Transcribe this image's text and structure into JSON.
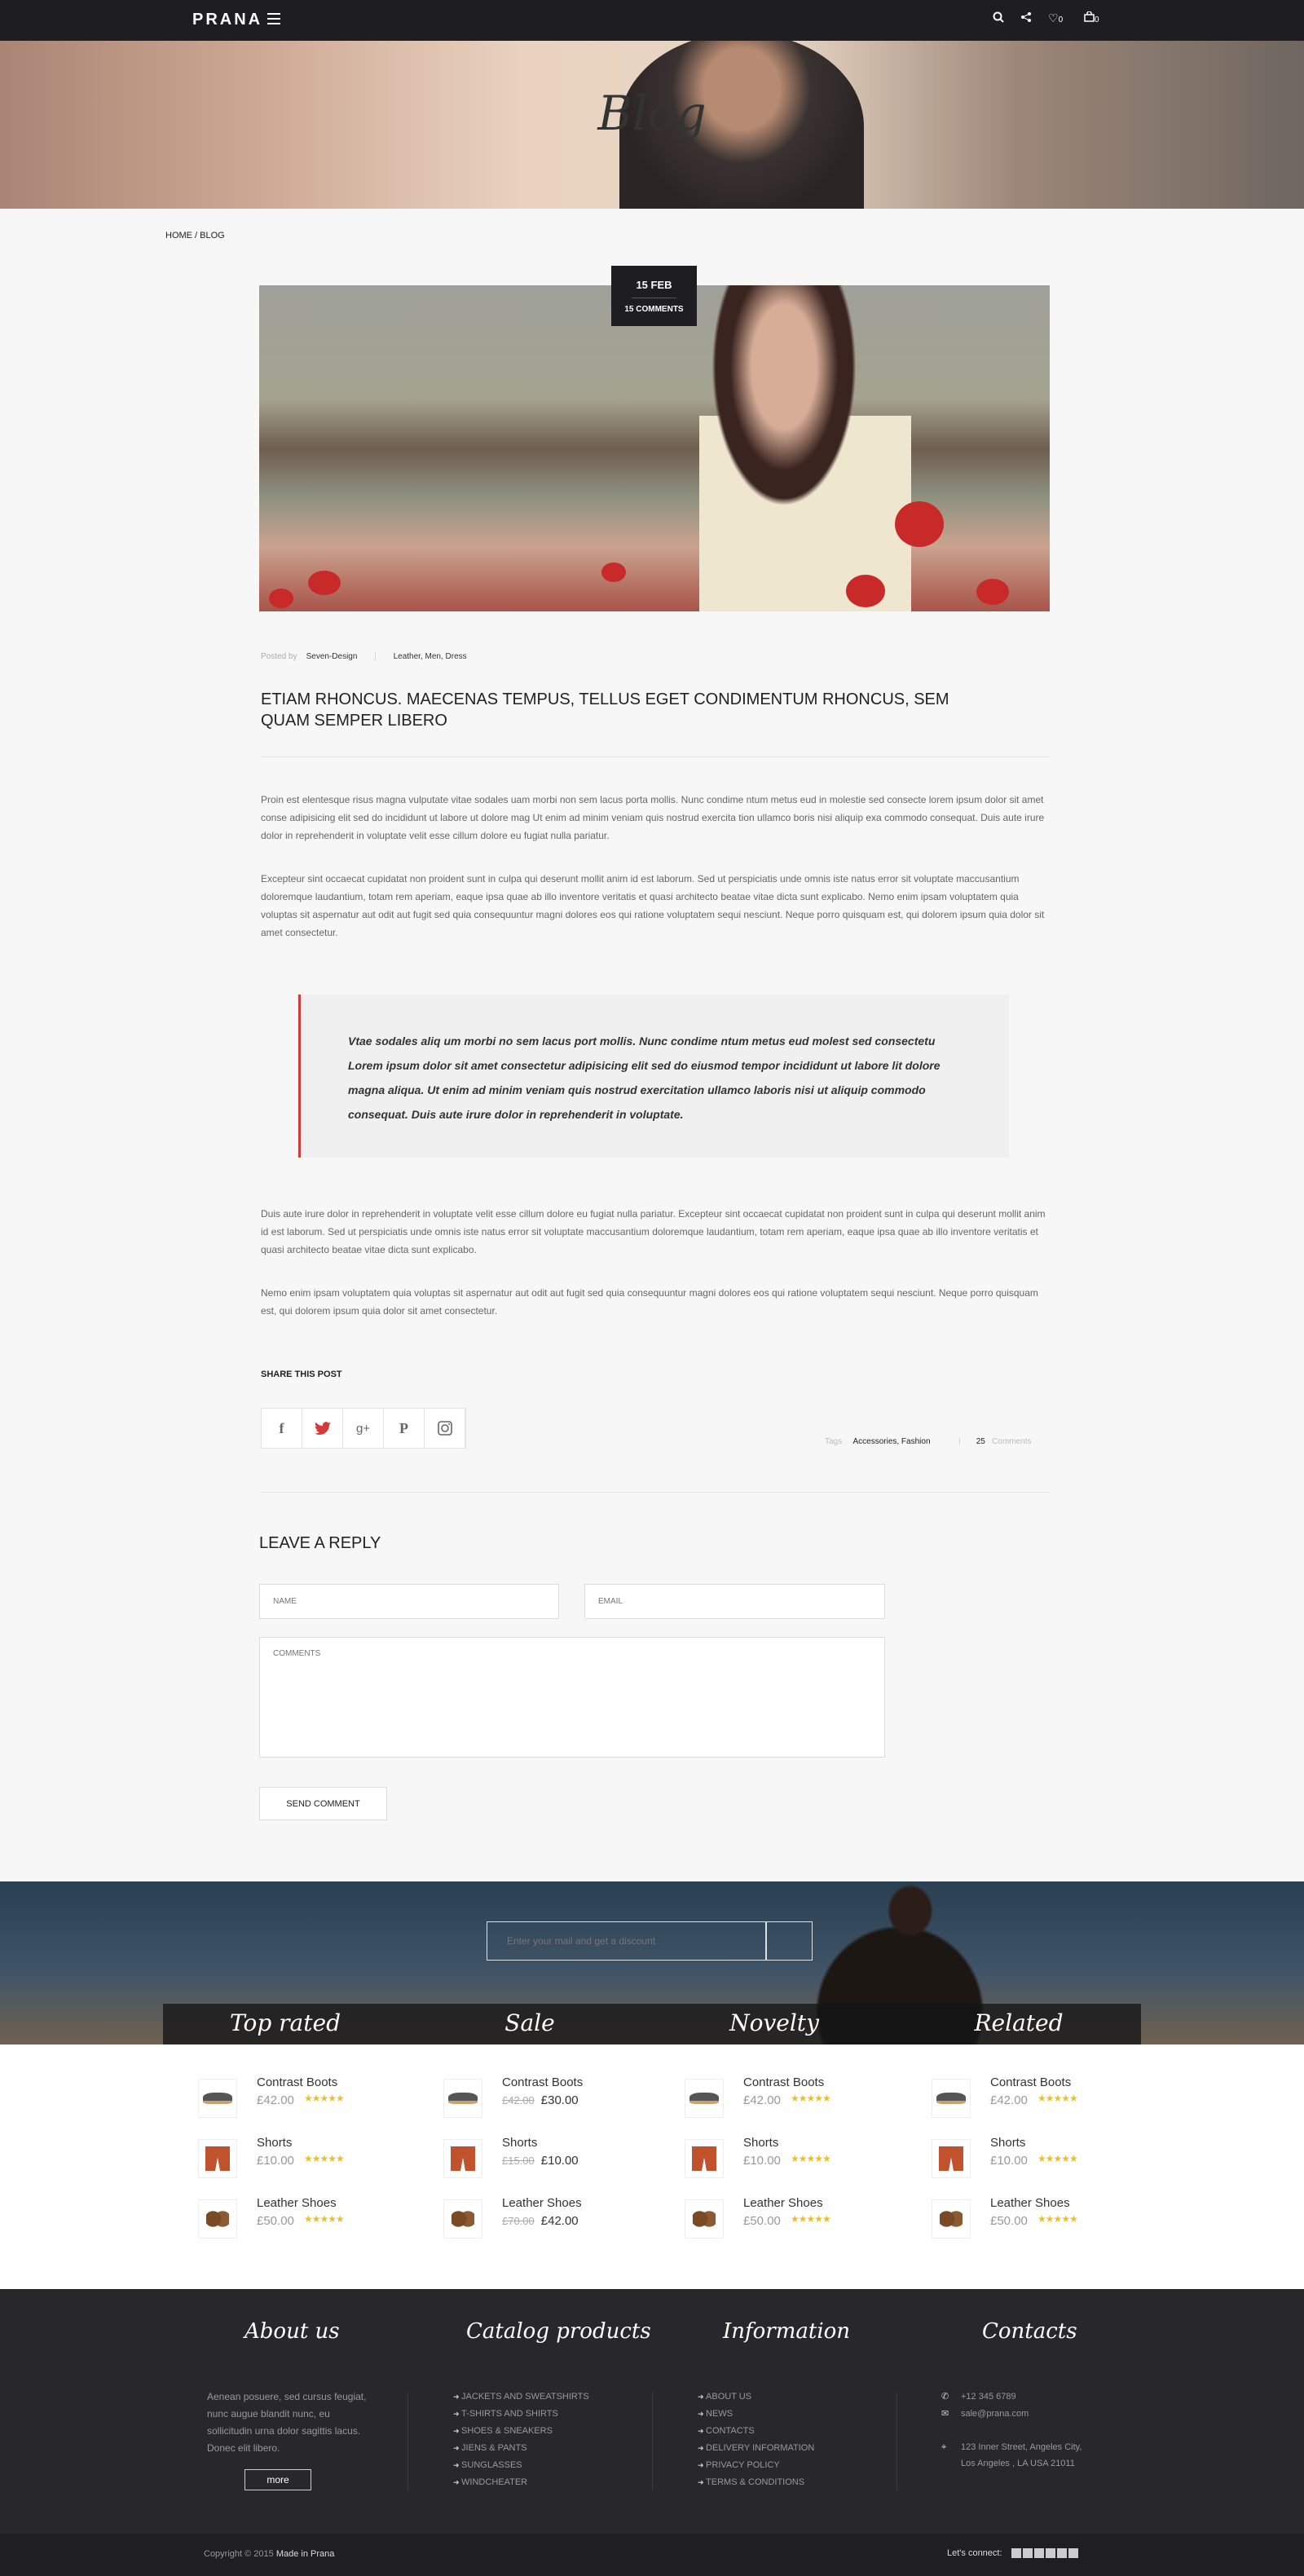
{
  "header": {
    "logo": "PRANA",
    "wishlist_count": "0",
    "cart_count": "0"
  },
  "hero": {
    "title": "Blog"
  },
  "breadcrumb": "HOME / BLOG",
  "post": {
    "date": "15 FEB",
    "comments_label": "15 COMMENTS",
    "posted_by_label": "Posted by",
    "author": "Seven-Design",
    "categories": "Leather, Men, Dress",
    "title": "ETIAM RHONCUS. MAECENAS TEMPUS, TELLUS EGET CONDIMENTUM RHONCUS, SEM QUAM SEMPER LIBERO",
    "paragraph1": "Proin est elentesque risus magna vulputate vitae sodales uam morbi non sem lacus porta mollis. Nunc condime ntum metus eud in molestie sed consecte lorem ipsum dolor sit amet conse adipisicing elit sed do incididunt ut labore ut dolore mag Ut enim ad minim veniam quis nostrud exercita tion ullamco boris nisi aliquip exa commodo consequat. Duis aute irure dolor in reprehenderit in voluptate velit esse cillum dolore eu fugiat nulla pariatur.",
    "paragraph2": "Excepteur sint occaecat cupidatat non proident sunt in culpa qui deserunt mollit anim id est laborum. Sed ut perspiciatis unde omnis iste natus error sit voluptate maccusantium doloremque laudantium, totam rem aperiam, eaque ipsa quae ab illo inventore veritatis et quasi architecto beatae vitae dicta sunt explicabo. Nemo enim ipsam voluptatem quia voluptas sit aspernatur aut odit aut fugit sed quia consequuntur magni dolores eos qui ratione voluptatem sequi nesciunt. Neque porro quisquam est, qui dolorem ipsum quia dolor sit amet consectetur.",
    "quote": "Vtae sodales aliq um morbi no sem lacus port mollis. Nunc condime ntum metus eud molest sed consectetu Lorem ipsum dolor sit amet consectetur adipisicing elit sed do eiusmod tempor incididunt ut labore lit dolore magna aliqua. Ut enim ad minim veniam quis nostrud exercitation ullamco laboris nisi ut aliquip commodo consequat. Duis aute irure dolor in reprehenderit in voluptate.",
    "paragraph3": "Duis aute irure dolor in reprehenderit in voluptate velit esse cillum dolore eu fugiat nulla pariatur. Excepteur sint occaecat cupidatat non proident sunt in culpa qui deserunt mollit anim id est laborum. Sed ut perspiciatis unde omnis iste natus error sit voluptate maccusantium doloremque laudantium, totam rem aperiam, eaque ipsa quae ab illo inventore veritatis et quasi architecto beatae vitae dicta sunt explicabo.",
    "paragraph4": "Nemo enim ipsam voluptatem quia voluptas sit aspernatur aut odit aut fugit sed quia consequuntur magni dolores eos qui ratione voluptatem sequi nesciunt. Neque porro quisquam est, qui dolorem ipsum quia dolor sit amet consectetur.",
    "share_title": "SHARE THIS POST",
    "tags_label": "Tags",
    "tags": "Accessories, Fashion",
    "comment_count": "25",
    "comments_word": "Comments"
  },
  "reply": {
    "title": "LEAVE A REPLY",
    "name_placeholder": "NAME",
    "email_placeholder": "EMAIL",
    "comments_placeholder": "COMMENTS",
    "send_label": "SEND COMMENT"
  },
  "newsletter": {
    "placeholder": "Enter your mail and get a discount"
  },
  "product_tabs": [
    "Top rated",
    "Sale",
    "Novelty",
    "Related"
  ],
  "product_columns": [
    {
      "items": [
        {
          "name": "Contrast Boots",
          "old_price": "",
          "price": "£42.00"
        },
        {
          "name": "Shorts",
          "old_price": "",
          "price": "£10.00"
        },
        {
          "name": "Leather Shoes",
          "old_price": "",
          "price": "£50.00"
        }
      ]
    },
    {
      "items": [
        {
          "name": "Contrast Boots",
          "old_price": "£42.00",
          "price": "£30.00"
        },
        {
          "name": "Shorts",
          "old_price": "£15.00",
          "price": "£10.00"
        },
        {
          "name": "Leather Shoes",
          "old_price": "£70.00",
          "price": "£42.00"
        }
      ]
    },
    {
      "items": [
        {
          "name": "Contrast Boots",
          "old_price": "",
          "price": "£42.00"
        },
        {
          "name": "Shorts",
          "old_price": "",
          "price": "£10.00"
        },
        {
          "name": "Leather Shoes",
          "old_price": "",
          "price": "£50.00"
        }
      ]
    },
    {
      "items": [
        {
          "name": "Contrast Boots",
          "old_price": "",
          "price": "£42.00"
        },
        {
          "name": "Shorts",
          "old_price": "",
          "price": "£10.00"
        },
        {
          "name": "Leather Shoes",
          "old_price": "",
          "price": "£50.00"
        }
      ]
    }
  ],
  "footer": {
    "about_title": "About us",
    "about_text": "Aenean posuere, sed cursus feugiat, nunc augue blandit nunc, eu sollicitudin urna dolor sagittis lacus. Donec elit libero.",
    "more_label": "more",
    "catalog_title": "Catalog products",
    "catalog_links": [
      "JACKETS AND SWEATSHIRTS",
      "T-SHIRTS AND SHIRTS",
      "SHOES & SNEAKERS",
      "JIENS & PANTS",
      "SUNGLASSES",
      "WINDCHEATER"
    ],
    "info_title": "Information",
    "info_links": [
      "ABOUT US",
      "NEWS",
      "CONTACTS",
      "DELIVERY INFORMATION",
      "PRIVACY POLICY",
      "TERMS & CONDITIONS"
    ],
    "contacts_title": "Contacts",
    "phone": "+12 345 6789",
    "email": "sale@prana.com",
    "address_line1": "123 Inner Street, Angeles City,",
    "address_line2": "Los Angeles , LA USA 21011",
    "copyright": "Copyright © 2015",
    "made_in": "Made in Prana",
    "connect_label": "Let's connect:"
  },
  "colors": {
    "accent": "#d43a3a",
    "dark": "#1e1e22",
    "star": "#e8c12a"
  }
}
